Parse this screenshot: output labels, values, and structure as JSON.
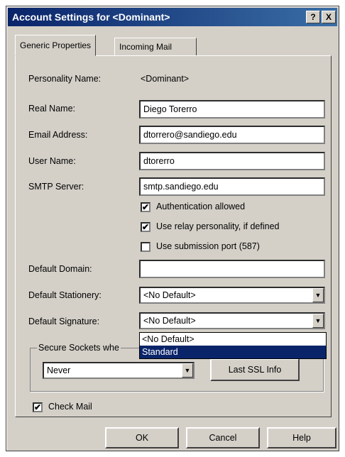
{
  "window": {
    "title": "Account Settings for <Dominant>",
    "help_glyph": "?",
    "close_glyph": "X"
  },
  "tabs": [
    {
      "label": "Generic Properties"
    },
    {
      "label": "Incoming Mail"
    }
  ],
  "form": {
    "personality_label": "Personality Name:",
    "personality_value": "<Dominant>",
    "real_name_label": "Real Name:",
    "real_name_value": "Diego Torerro",
    "email_label": "Email Address:",
    "email_value": "dtorrero@sandiego.edu",
    "username_label": "User Name:",
    "username_value": "dtorerro",
    "smtp_label": "SMTP Server:",
    "smtp_value": "smtp.sandiego.edu",
    "auth_label": "Authentication allowed",
    "auth_checked": "✔",
    "relay_label": "Use relay personality, if defined",
    "relay_checked": "✔",
    "submission_label": "Use submission port (587)",
    "submission_checked": "",
    "domain_label": "Default Domain:",
    "domain_value": "",
    "stationery_label": "Default Stationery:",
    "stationery_value": "<No Default>",
    "signature_label": "Default Signature:",
    "signature_value": "<No Default>",
    "signature_options": [
      "<No Default>",
      "Standard"
    ],
    "ssl_group_label": "Secure Sockets whe",
    "ssl_value": "Never",
    "ssl_info_button": "Last SSL Info",
    "check_mail_label": "Check Mail",
    "check_mail_checked": "✔"
  },
  "footer": {
    "ok": "OK",
    "cancel": "Cancel",
    "help": "Help"
  },
  "colors": {
    "title_gradient_start": "#0a246a",
    "title_gradient_end": "#3a6ea5",
    "dialog_bg": "#d4d0c8",
    "selection": "#0a246a"
  }
}
